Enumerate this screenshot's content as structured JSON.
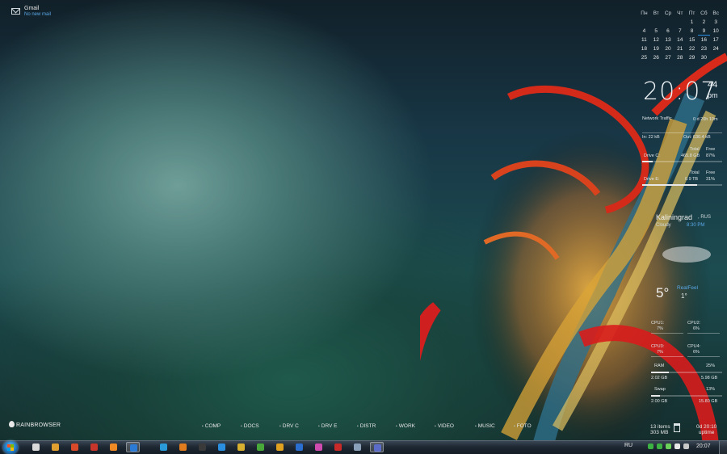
{
  "gmail": {
    "title": "Gmail",
    "status": "No new mail"
  },
  "calendar": {
    "weekdays": [
      "Пн",
      "Вт",
      "Ср",
      "Чт",
      "Пт",
      "Сб",
      "Вс"
    ],
    "weeks": [
      [
        "",
        "",
        "",
        "",
        "",
        "1",
        "2",
        "3",
        "4"
      ],
      [
        "5",
        "6",
        "7",
        "8",
        "9",
        "10",
        "11"
      ],
      [
        "12",
        "13",
        "14",
        "15",
        "16",
        "17",
        "18"
      ],
      [
        "19",
        "20",
        "21",
        "22",
        "23",
        "24",
        "25"
      ],
      [
        "26",
        "27",
        "28",
        "29",
        "30",
        "",
        ""
      ]
    ],
    "today": "9"
  },
  "clock": {
    "time": "20:07",
    "seconds": "44",
    "ampm": "pm"
  },
  "network": {
    "label": "Network Traffic",
    "uptime": "0 d 20h 10m",
    "in": "In: 22 kB",
    "out": "Out: 630.4 kB"
  },
  "drive_c": {
    "label": "Drive C:",
    "total_label": "Total",
    "free_label": "Free",
    "total": "465.8 GB",
    "free": "87%",
    "used_fraction": 0.13
  },
  "drive_e": {
    "label": "Drive E:",
    "total_label": "Total",
    "free_label": "Free",
    "total": "0.9 TB",
    "free": "31%",
    "used_fraction": 0.69
  },
  "weather": {
    "city": "Kaliningrad",
    "country": ", RUS",
    "sub": "Cloudy",
    "time": "8:30 PM",
    "temp": "5°",
    "realfeel_label": "RealFeel",
    "realfeel": "1°"
  },
  "cpu": [
    {
      "label": "CPU1:",
      "value": "7%"
    },
    {
      "label": "CPU2:",
      "value": "6%"
    },
    {
      "label": "CPU3:",
      "value": "7%"
    },
    {
      "label": "CPU4:",
      "value": "6%"
    }
  ],
  "ram": {
    "label": "RAM",
    "value": "25%",
    "used": "2.02 GB",
    "total": "5.98 GB",
    "fraction": 0.25
  },
  "swap": {
    "label": "Swap",
    "value": "13%",
    "used": "2.00 GB",
    "total": "15.80 GB",
    "fraction": 0.13
  },
  "launcher": {
    "brand": "RAINBROWSER",
    "items": [
      "COMP",
      "DOCS",
      "DRV C",
      "DRV E",
      "DISTR",
      "WORK",
      "VIDEO",
      "MUSIC",
      "FOTO"
    ]
  },
  "recycle": {
    "items": "13 items",
    "size": "303 MB"
  },
  "uptime": {
    "value": "0d 20:10",
    "label": "uptime"
  },
  "taskbar": {
    "lang": "RU",
    "clock": "20:07",
    "icon_colors": [
      "#d9d9d9",
      "#e0a030",
      "#d84a2a",
      "#c8352a",
      "#f08a24",
      "#2b7bd6",
      "#2a9bd8",
      "#e07b1e",
      "#3a3a3a",
      "#2a8fe0",
      "#d8b030",
      "#49a83a",
      "#e0a020",
      "#2a6fcf",
      "#d04bb0",
      "#c82a2a",
      "#8aa0b8",
      "#5a6cc8"
    ],
    "tray_colors": [
      "#3cb043",
      "#3cb043",
      "#6ad05a",
      "#e8e8e8",
      "#c8c8c8"
    ]
  }
}
